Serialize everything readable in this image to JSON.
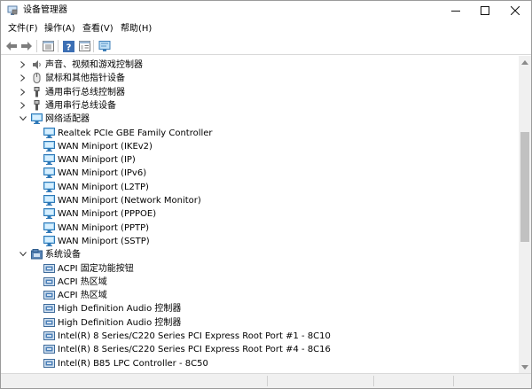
{
  "window": {
    "title": "设备管理器"
  },
  "menubar": {
    "items": [
      {
        "label": "文件(F)"
      },
      {
        "label": "操作(A)"
      },
      {
        "label": "查看(V)"
      },
      {
        "label": "帮助(H)"
      }
    ]
  },
  "toolbar": {
    "buttons": [
      {
        "icon": "back-arrow-icon"
      },
      {
        "icon": "forward-arrow-icon"
      },
      {
        "icon": "properties-icon"
      },
      {
        "icon": "help-icon"
      },
      {
        "icon": "details-view-icon"
      },
      {
        "icon": "monitor-scan-icon"
      }
    ]
  },
  "tree": {
    "rows": [
      {
        "label": "声音、视频和游戏控制器",
        "expander": "collapsed",
        "icon": "speaker-icon"
      },
      {
        "label": "鼠标和其他指针设备",
        "expander": "collapsed",
        "icon": "mouse-icon"
      },
      {
        "label": "通用串行总线控制器",
        "expander": "collapsed",
        "icon": "usb-icon"
      },
      {
        "label": "通用串行总线设备",
        "expander": "collapsed",
        "icon": "usb-icon"
      },
      {
        "label": "网络适配器",
        "expander": "expanded",
        "icon": "network-adapter-icon"
      },
      {
        "label": "Realtek PCIe GBE Family Controller",
        "icon": "network-adapter-icon"
      },
      {
        "label": "WAN Miniport (IKEv2)",
        "icon": "network-adapter-icon"
      },
      {
        "label": "WAN Miniport (IP)",
        "icon": "network-adapter-icon"
      },
      {
        "label": "WAN Miniport (IPv6)",
        "icon": "network-adapter-icon"
      },
      {
        "label": "WAN Miniport (L2TP)",
        "icon": "network-adapter-icon"
      },
      {
        "label": "WAN Miniport (Network Monitor)",
        "icon": "network-adapter-icon"
      },
      {
        "label": "WAN Miniport (PPPOE)",
        "icon": "network-adapter-icon"
      },
      {
        "label": "WAN Miniport (PPTP)",
        "icon": "network-adapter-icon"
      },
      {
        "label": "WAN Miniport (SSTP)",
        "icon": "network-adapter-icon"
      },
      {
        "label": "系统设备",
        "expander": "expanded",
        "icon": "system-device-folder-icon"
      },
      {
        "label": "ACPI 固定功能按钮",
        "icon": "system-device-icon"
      },
      {
        "label": "ACPI 热区域",
        "icon": "system-device-icon"
      },
      {
        "label": "ACPI 热区域",
        "icon": "system-device-icon"
      },
      {
        "label": "High Definition Audio 控制器",
        "icon": "system-device-icon"
      },
      {
        "label": "High Definition Audio 控制器",
        "icon": "system-device-icon"
      },
      {
        "label": "Intel(R) 8 Series/C220 Series PCI Express Root Port #1 - 8C10",
        "icon": "system-device-icon"
      },
      {
        "label": "Intel(R) 8 Series/C220 Series PCI Express Root Port #4 - 8C16",
        "icon": "system-device-icon"
      },
      {
        "label": "Intel(R) B85 LPC Controller - 8C50",
        "icon": "system-device-icon"
      }
    ]
  },
  "colors": {
    "accent": "#1e73c8",
    "scrollbar_thumb": "#c1c1c1"
  }
}
